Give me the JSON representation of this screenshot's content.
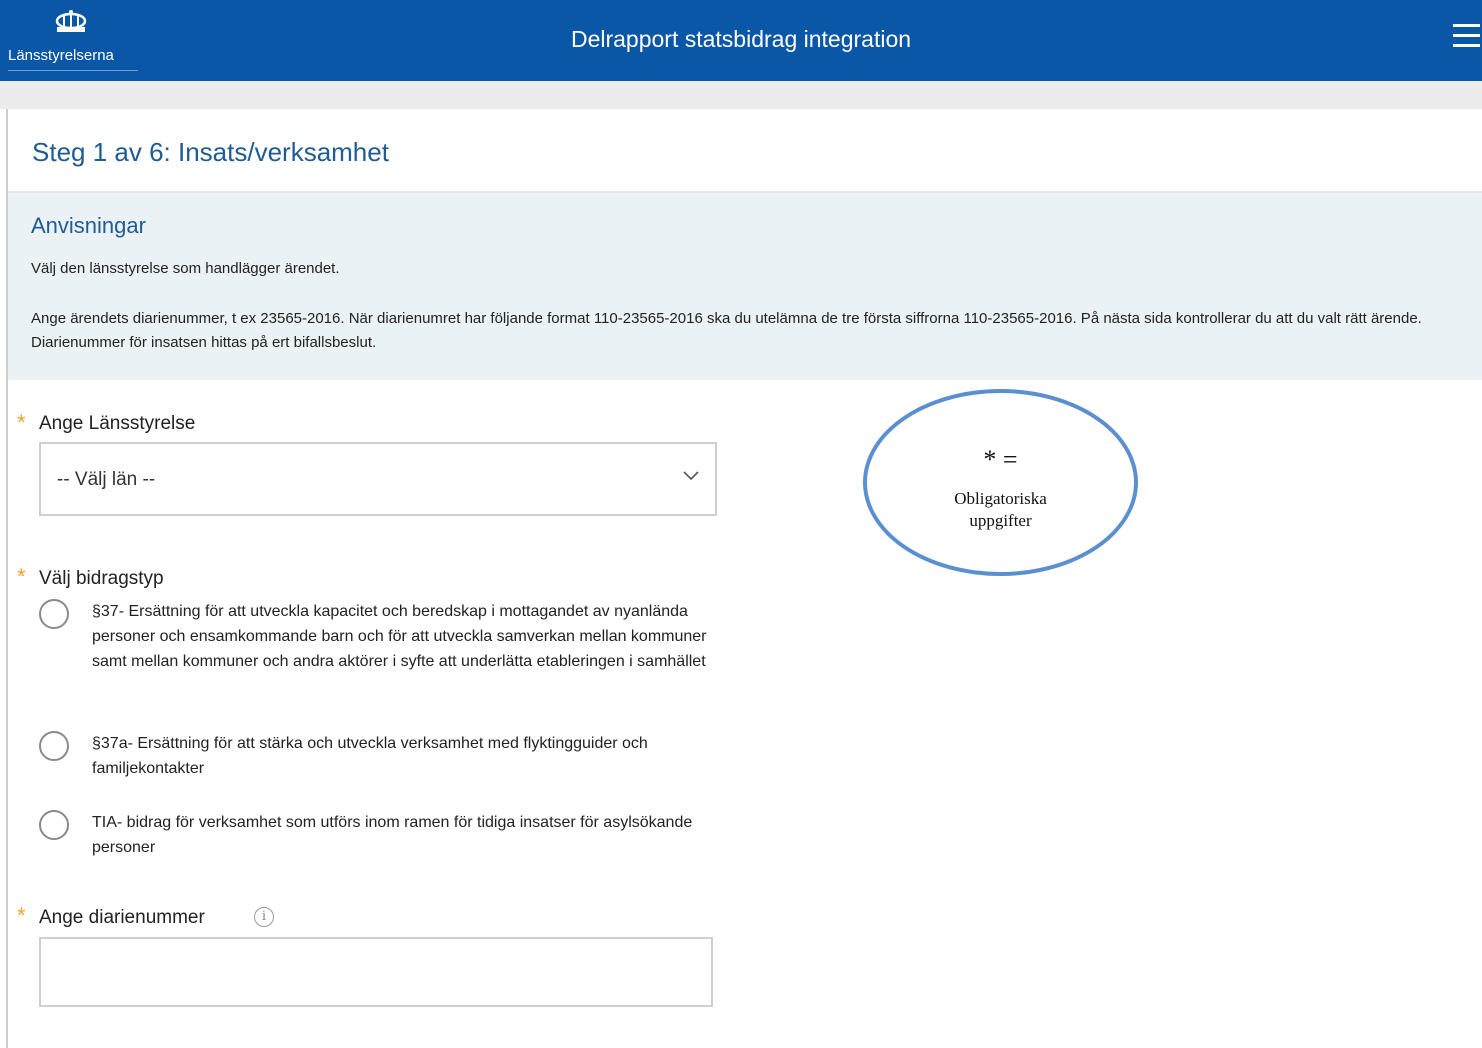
{
  "header": {
    "logo_text": "Länsstyrelserna",
    "title": "Delrapport statsbidrag integration",
    "menu_icon": "hamburger-menu-icon",
    "background": "#0a57a8"
  },
  "step": {
    "title": "Steg 1 av 6:  Insats/verksamhet"
  },
  "instructions": {
    "heading": "Anvisningar",
    "paragraph1": "Välj den länsstyrelse som handlägger ärendet.",
    "paragraph2": "Ange ärendets diarienummer, t ex 23565-2016. När diarienumret har följande format 110-23565-2016 ska du utelämna de tre första siffrorna 110-23565-2016. På nästa sida kontrollerar du att du valt rätt ärende. Diarienummer för insatsen hittas på ert bifallsbeslut."
  },
  "form": {
    "required_marker": "*",
    "lansstyrelse": {
      "label": "Ange Länsstyrelse",
      "selected": "-- Välj län --"
    },
    "bidragstyp": {
      "label": "Välj bidragstyp",
      "options": [
        "§37- Ersättning för att utveckla kapacitet och beredskap i mottagandet av nyanlända personer och ensamkommande barn och för att utveckla samverkan mellan kommuner samt mellan kommuner och andra aktörer i syfte att underlätta etableringen i samhället",
        "§37a- Ersättning för att stärka och utveckla verksamhet med flyktingguider och familjekontakter",
        "TIA- bidrag för verksamhet som utförs inom ramen för tidiga insatser för asylsökande personer"
      ]
    },
    "diarienummer": {
      "label": "Ange diarienummer",
      "info_icon": "i",
      "value": ""
    }
  },
  "annotation": {
    "symbol": "* =",
    "line1": "Obligatoriska",
    "line2": "uppgifter"
  }
}
